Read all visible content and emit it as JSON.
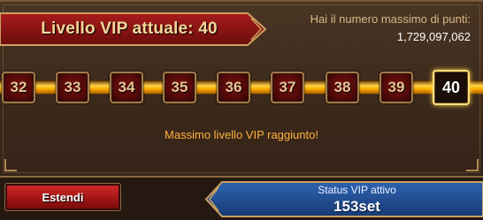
{
  "header": {
    "vip_label": "Livello VIP attuale: 40",
    "max_points_text": "Hai il numero massimo di punti:",
    "max_points_value": "1,729,097,062"
  },
  "levels": [
    "32",
    "33",
    "34",
    "35",
    "36",
    "37",
    "38",
    "39",
    "40"
  ],
  "current_level": "40",
  "max_message": "Massimo livello VIP raggiunto!",
  "footer": {
    "extend_button": "Estendi",
    "status_label": "Status VIP attivo",
    "status_value": "153set"
  },
  "colors": {
    "banner_red": "#8a1414",
    "gold": "#ffb000",
    "status_blue": "#1f4a8a",
    "button_red": "#b01a1a"
  }
}
